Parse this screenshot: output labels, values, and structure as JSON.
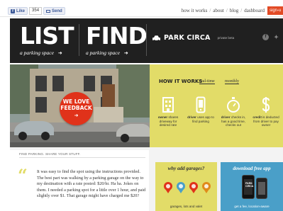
{
  "topbar": {
    "like_label": "Like",
    "like_count": "354",
    "send_label": "Send",
    "nav": [
      "how it works",
      "about",
      "blog",
      "dashboard"
    ],
    "nav_separator": "/",
    "signup_label": "sign-u"
  },
  "header": {
    "headline_left": "LIST",
    "subline_left": "a parking space",
    "headline_right": "FIND",
    "subline_right": "a parking space",
    "arrow": "➜",
    "brand_name": "PARK CIRCA",
    "brand_tag": "private beta",
    "social": [
      "facebook-icon",
      "twitter-icon"
    ]
  },
  "hero": {
    "badge_text_line1": "WE LOVE",
    "badge_text_line2": "FEEDBACK",
    "badge_arrow": "➜"
  },
  "how_it_works": {
    "title": "HOW IT WORKS",
    "tabs": [
      "real-time",
      "monthly"
    ],
    "steps": [
      {
        "icon": "building-icon",
        "bold": "owner",
        "text": "shares driveway for desired rate"
      },
      {
        "icon": "phone-icon",
        "bold": "driver",
        "text": "uses app to find parking"
      },
      {
        "icon": "stopwatch-icon",
        "bold": "driver",
        "text": "checks in, has a good time, checks out"
      },
      {
        "icon": "dollar-icon",
        "bold": "credit",
        "text": "is deducted from driver to pay owner"
      }
    ]
  },
  "story": {
    "header": "FIND PARKING. SHARE YOUR STUFF.",
    "quote_mark": "“",
    "text": "It was easy to find the spot using the instructions provided. The best part was walking by a parking garage on the way to my destination with a rate posted: $20/hr. Ha ha. Jokes on them. I needed a parking spot for a little over 1 hour, and paid slightly over $1. That garage might have charged me $20?"
  },
  "garages": {
    "title": "why add garages?",
    "footer": "garages, lots and valet"
  },
  "app": {
    "title": "download free app",
    "phone_text": "PARK CIRCA",
    "footer": "get a fee, location-aware"
  },
  "colors": {
    "accent_yellow": "#e2dc68",
    "accent_red": "#e0321a",
    "header_dark": "#202020",
    "app_blue": "#4a9fc8"
  }
}
